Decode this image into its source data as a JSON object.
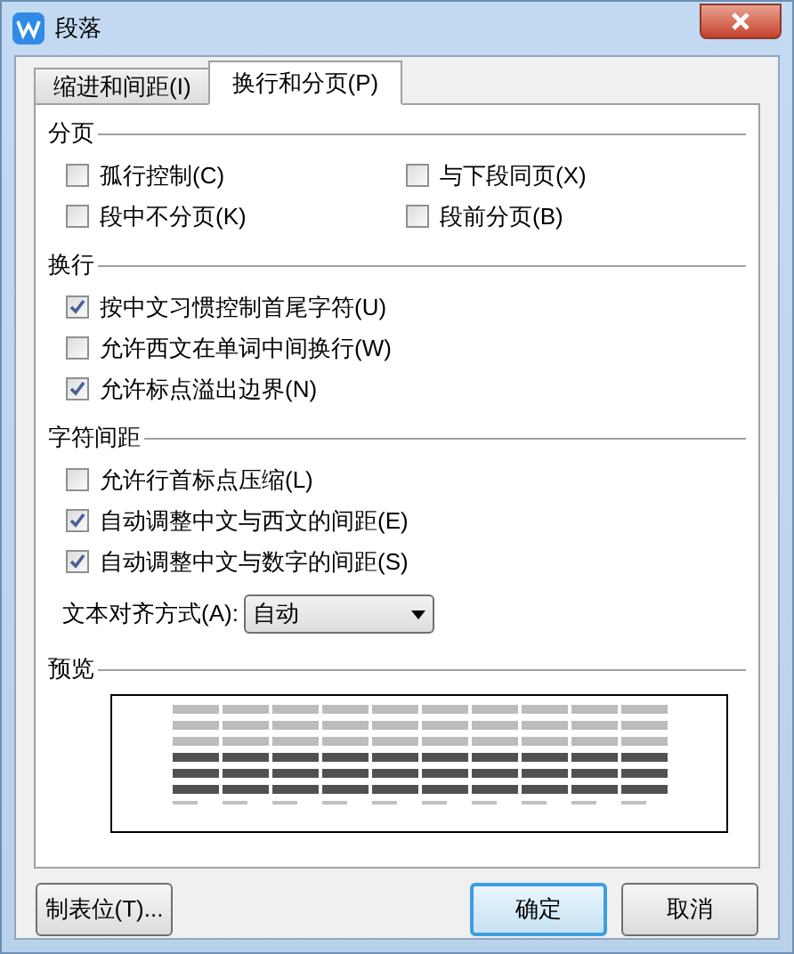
{
  "window": {
    "title": "段落"
  },
  "tabs": [
    {
      "label": "缩进和间距(I)",
      "selected": false
    },
    {
      "label": "换行和分页(P)",
      "selected": true
    }
  ],
  "sections": [
    {
      "title": "分页",
      "kind": "grid",
      "options": [
        {
          "label": "孤行控制(C)",
          "checked": false
        },
        {
          "label": "与下段同页(X)",
          "checked": false
        },
        {
          "label": "段中不分页(K)",
          "checked": false
        },
        {
          "label": "段前分页(B)",
          "checked": false
        }
      ]
    },
    {
      "title": "换行",
      "kind": "list",
      "options": [
        {
          "label": "按中文习惯控制首尾字符(U)",
          "checked": true
        },
        {
          "label": "允许西文在单词中间换行(W)",
          "checked": false
        },
        {
          "label": "允许标点溢出边界(N)",
          "checked": true
        }
      ]
    },
    {
      "title": "字符间距",
      "kind": "list",
      "options": [
        {
          "label": "允许行首标点压缩(L)",
          "checked": false
        },
        {
          "label": "自动调整中文与西文的间距(E)",
          "checked": true
        },
        {
          "label": "自动调整中文与数字的间距(S)",
          "checked": true
        }
      ]
    }
  ],
  "alignment": {
    "label": "文本对齐方式(A):",
    "value": "自动"
  },
  "preview": {
    "title": "预览"
  },
  "buttons": [
    {
      "label": "制表位(T)...",
      "kind": "secondary"
    },
    {
      "label": "确定",
      "kind": "default"
    },
    {
      "label": "取消",
      "kind": "normal"
    }
  ]
}
